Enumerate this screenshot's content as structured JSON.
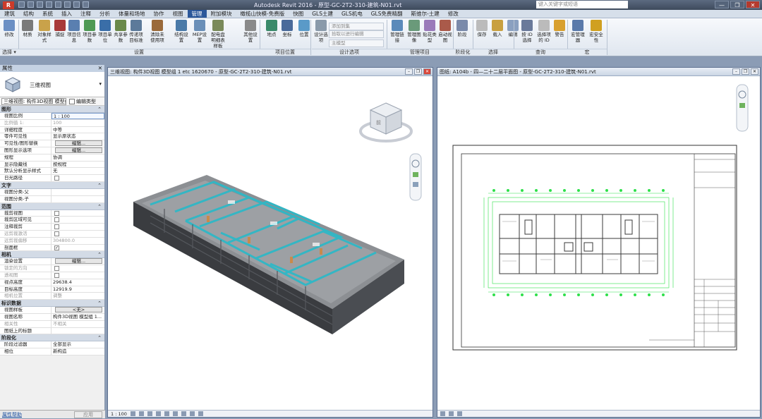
{
  "window": {
    "app_icon": "R",
    "title": "Autodesk Revit 2016 -   原型-GC-2T2-310-建筑-N01.rvt",
    "search_placeholder": "键入关键字或短语",
    "controls": [
      "—",
      "❐",
      "✕"
    ]
  },
  "ribbon_tabs": [
    "建筑",
    "结构",
    "系统",
    "插入",
    "注释",
    "分析",
    "体量和场地",
    "协作",
    "视图",
    "管理",
    "附加模块",
    "橄榄山快模-免费版",
    "快图",
    "GLS土建",
    "GLS机电",
    "GLS免费精翻",
    "斯维尔-土建",
    "修改"
  ],
  "active_tab": "管理",
  "ribbon_buttons": [
    {
      "label": "修改",
      "color": "#6b8fc4"
    },
    {
      "label": "材质",
      "color": "#7a7a7a"
    },
    {
      "label": "对象样式",
      "color": "#c9a24a"
    },
    {
      "label": "捕捉",
      "color": "#a83a3a"
    },
    {
      "label": "项目信息",
      "color": "#5a7fb0"
    },
    {
      "label": "项目参数",
      "color": "#4f9a55"
    },
    {
      "label": "项目单位",
      "color": "#3a6ea8"
    },
    {
      "label": "共享参数",
      "color": "#6b8a4a"
    },
    {
      "label": "传递项目标准",
      "color": "#5c7a9a"
    },
    {
      "label": "清除未使用项",
      "color": "#9a6a3a"
    },
    {
      "label": "结构设置",
      "color": "#4a7aa8"
    },
    {
      "label": "MEP设置",
      "color": "#6a8fb8"
    },
    {
      "label": "配电盘明细表样板",
      "color": "#7a8a5a"
    },
    {
      "label": "其他设置",
      "color": "#8a8a8a"
    },
    {
      "label": "地点",
      "color": "#3a8a6a"
    },
    {
      "label": "坐标",
      "color": "#4a6a9a"
    },
    {
      "label": "位置",
      "color": "#5a9ac8"
    },
    {
      "label": "设计选项",
      "color": "#8a9aaa"
    },
    {
      "label": "管理链接",
      "color": "#5a8aba"
    },
    {
      "label": "管理图像",
      "color": "#6a9a7a"
    },
    {
      "label": "贴花类型",
      "color": "#9a7aba"
    },
    {
      "label": "启动视图",
      "color": "#aa5a4a"
    },
    {
      "label": "阶段",
      "color": "#7a8aaa"
    },
    {
      "label": "保存",
      "color": "#bbbbbb"
    },
    {
      "label": "载入",
      "color": "#c8a040"
    },
    {
      "label": "编辑",
      "color": "#8aa0c0"
    },
    {
      "label": "按 ID 选择",
      "color": "#6a7a9a"
    },
    {
      "label": "选择项的 ID",
      "color": "#bbbbbb"
    },
    {
      "label": "警告",
      "color": "#d8a030"
    },
    {
      "label": "宏管理器",
      "color": "#5a7aaa"
    },
    {
      "label": "宏安全性",
      "color": "#d0a020"
    }
  ],
  "ribbon_small": [
    "添加到集",
    "拾取以进行编辑",
    "主模型"
  ],
  "ribbon_groups": [
    "选择 ▾",
    "设置",
    "项目位置",
    "设计选项",
    "管理项目",
    "阶段化",
    "选择",
    "查询",
    "宏"
  ],
  "properties": {
    "header": "属性",
    "type_name": "三维视图",
    "view_selector": "三维视图: 构件3D视图 模型组 1",
    "edit_type": "编辑类型",
    "sections": [
      {
        "title": "图形",
        "rows": [
          {
            "k": "视图比例",
            "v": "1 : 100",
            "kind": "input"
          },
          {
            "k": "比例值 1:",
            "v": "100",
            "kind": "dis"
          },
          {
            "k": "详细程度",
            "v": "中等"
          },
          {
            "k": "零件可见性",
            "v": "显示原状态"
          },
          {
            "k": "可见性/图形替换",
            "v": "编辑...",
            "kind": "btn"
          },
          {
            "k": "图形显示选项",
            "v": "编辑...",
            "kind": "btn"
          },
          {
            "k": "规程",
            "v": "协调"
          },
          {
            "k": "显示隐藏线",
            "v": "按规程"
          },
          {
            "k": "默认分析显示样式",
            "v": "无"
          },
          {
            "k": "日光路径",
            "v": "",
            "kind": "chk"
          }
        ]
      },
      {
        "title": "文字",
        "rows": [
          {
            "k": "视图分类-父",
            "v": ""
          },
          {
            "k": "视图分类-子",
            "v": ""
          }
        ]
      },
      {
        "title": "范围",
        "rows": [
          {
            "k": "裁剪视图",
            "v": "",
            "kind": "chk"
          },
          {
            "k": "裁剪区域可见",
            "v": "",
            "kind": "chk"
          },
          {
            "k": "注释裁剪",
            "v": "",
            "kind": "chk"
          },
          {
            "k": "远剪裁激活",
            "v": "",
            "kind": "chkdis"
          },
          {
            "k": "远剪裁偏移",
            "v": "304800.0",
            "kind": "dis"
          },
          {
            "k": "剖面框",
            "v": "",
            "kind": "chkon"
          }
        ]
      },
      {
        "title": "相机",
        "rows": [
          {
            "k": "渲染设置",
            "v": "编辑...",
            "kind": "btn"
          },
          {
            "k": "锁定的方向",
            "v": "",
            "kind": "chkdis"
          },
          {
            "k": "透视图",
            "v": "",
            "kind": "chkdis"
          },
          {
            "k": "视点高度",
            "v": "29638.4"
          },
          {
            "k": "目标高度",
            "v": "12919.9"
          },
          {
            "k": "相机位置",
            "v": "调整",
            "kind": "dis"
          }
        ]
      },
      {
        "title": "标识数据",
        "rows": [
          {
            "k": "视图样板",
            "v": "<无>",
            "kind": "btn"
          },
          {
            "k": "视图名称",
            "v": "构件3D视图 模型组 1..."
          },
          {
            "k": "相关性",
            "v": "不相关",
            "kind": "dis"
          },
          {
            "k": "图纸上的标题",
            "v": ""
          }
        ]
      },
      {
        "title": "阶段化",
        "rows": [
          {
            "k": "阶段过滤器",
            "v": "全部显示"
          },
          {
            "k": "相位",
            "v": "新构造"
          }
        ]
      }
    ],
    "help_link": "属性帮助",
    "apply": "应用"
  },
  "view3d": {
    "title": "三维视图: 构件3D视图 模型组 1 etc 1620670 - 原型-GC-2T2-310-建筑-N01.rvt",
    "viewcube_face": "前",
    "scale": "1 : 100"
  },
  "sheet": {
    "title": "图纸: A104b - 四—二十二层平面图 - 原型-GC-2T2-310-建筑-N01.rvt"
  },
  "colors": {
    "accent": "#2b579a",
    "model_cyan": "#2fb8c6",
    "grid_green": "#2ee04a"
  }
}
